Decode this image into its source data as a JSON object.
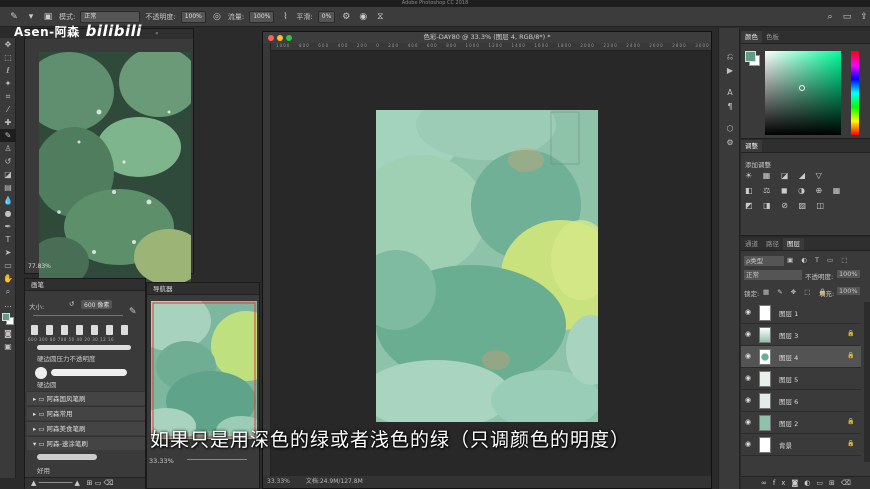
{
  "app": {
    "title": "Adobe Photoshop CC 2018"
  },
  "watermark": {
    "channel": "Asen-阿森",
    "site": "bilibili"
  },
  "options_bar": {
    "mode_label": "模式:",
    "mode_value": "正常",
    "opacity_label": "不透明度:",
    "opacity_value": "100%",
    "flow_label": "流量:",
    "flow_value": "100%",
    "smooth_label": "平滑:",
    "smooth_value": "0%"
  },
  "reference_panel": {
    "zoom": "77.83%"
  },
  "brush_panel": {
    "title": "画笔",
    "size_label": "大小:",
    "size_value": "600 像素",
    "presets": [
      "600",
      "300",
      "80",
      "700",
      "50",
      "40",
      "20",
      "30",
      "12",
      "16"
    ],
    "brush_items": [
      "硬边圆压力不透明度",
      "硬边圆"
    ],
    "folders": [
      "阿森国风笔刷",
      "阿森常用",
      "阿森美食笔刷",
      "阿森-速涂笔刷"
    ],
    "sub_item": "好用"
  },
  "navigator_panel": {
    "title": "导航器",
    "zoom": "33.33%"
  },
  "canvas_window": {
    "title": "色彩-DAY80 @ 33.3% (图层 4, RGB/8*) *",
    "ruler_marks": [
      "1000",
      "800",
      "600",
      "400",
      "200",
      "0",
      "200",
      "400",
      "600",
      "800",
      "1000",
      "1200",
      "1400",
      "1600",
      "1800",
      "2000",
      "2200",
      "2400",
      "2600",
      "2800",
      "3000"
    ],
    "zoom": "33.33%",
    "doc_info": "文档:24.9M/127.8M"
  },
  "subtitle": "如果只是用深色的绿或者浅色的绿（只调颜色的明度）",
  "color_panel": {
    "tabs": [
      "颜色",
      "色板"
    ]
  },
  "adjust_panel": {
    "tab": "调整",
    "label": "添加调整"
  },
  "layers_panel": {
    "tabs": [
      "通道",
      "路径",
      "图层"
    ],
    "filter_label": "ρ类型",
    "blend_mode": "正常",
    "opacity_label": "不透明度:",
    "opacity_value": "100%",
    "lock_label": "锁定:",
    "fill_label": "填充:",
    "fill_value": "100%",
    "layers": [
      {
        "name": "图层 1"
      },
      {
        "name": "图层 3"
      },
      {
        "name": "图层 4"
      },
      {
        "name": "图层 5"
      },
      {
        "name": "图层 6"
      },
      {
        "name": "图层 2"
      },
      {
        "name": "背景"
      }
    ],
    "footer": "fx"
  },
  "colors": {
    "foreground": "#5e9c86",
    "background": "#ffffff",
    "canvas_base": "#8fc0a8"
  }
}
